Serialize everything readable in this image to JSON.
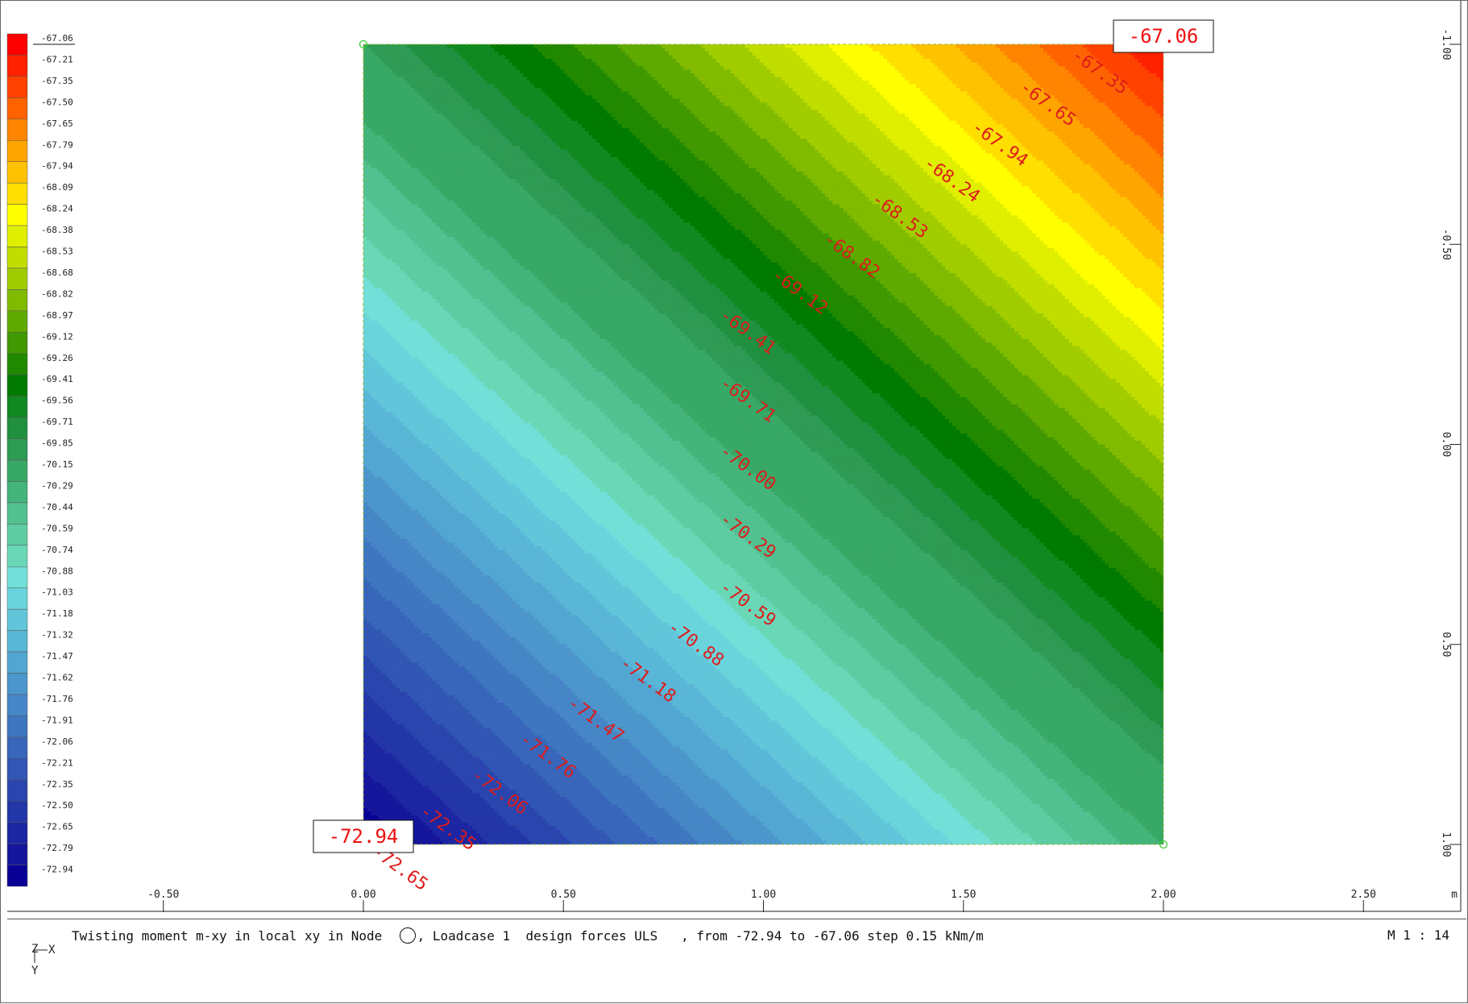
{
  "legend": {
    "values": [
      "-67.06",
      "-67.21",
      "-67.35",
      "-67.50",
      "-67.65",
      "-67.79",
      "-67.94",
      "-68.09",
      "-68.24",
      "-68.38",
      "-68.53",
      "-68.68",
      "-68.82",
      "-68.97",
      "-69.12",
      "-69.26",
      "-69.41",
      "-69.56",
      "-69.71",
      "-69.85",
      "-70.15",
      "-70.29",
      "-70.44",
      "-70.59",
      "-70.74",
      "-70.88",
      "-71.03",
      "-71.18",
      "-71.32",
      "-71.47",
      "-71.62",
      "-71.76",
      "-71.91",
      "-72.06",
      "-72.21",
      "-72.35",
      "-72.50",
      "-72.65",
      "-72.79",
      "-72.94"
    ],
    "colors": [
      "#ff0000",
      "#ff2100",
      "#ff4200",
      "#ff6300",
      "#ff8400",
      "#ffa500",
      "#ffc200",
      "#ffdf00",
      "#ffff00",
      "#e0ee00",
      "#c0dd00",
      "#a0cc00",
      "#80bb00",
      "#5faa00",
      "#409900",
      "#218900",
      "#007a00",
      "#108a20",
      "#209040",
      "#2e9b55",
      "#38a866",
      "#44b47a",
      "#52c090",
      "#5ecca2",
      "#6ad8b6",
      "#72e0d8",
      "#6ad4dc",
      "#62c6da",
      "#5ab6d6",
      "#52a6d2",
      "#4c96cc",
      "#4686c6",
      "#3f76c0",
      "#3866ba",
      "#3156b4",
      "#2a46ae",
      "#2336a8",
      "#1c26a2",
      "#15169c",
      "#0a0096"
    ]
  },
  "chart_data": {
    "type": "heatmap",
    "title": "Twisting moment m-xy in local xy in Node",
    "subtitle": ", Loadcase 1  design forces ULS   , from -72.94 to -67.06 step 0.15 kNm/m",
    "unit": "kNm/m",
    "min": -72.94,
    "max": -67.06,
    "step": 0.15,
    "x_ticks": [
      "-0.50",
      "0.00",
      "0.50",
      "1.00",
      "1.50",
      "2.00",
      "2.50"
    ],
    "x_tick_values": [
      -0.5,
      0,
      0.5,
      1,
      1.5,
      2,
      2.5
    ],
    "x_unit": "m",
    "y_ticks": [
      "-1.00",
      "-0.50",
      "0.00",
      "0.50",
      "1.00"
    ],
    "y_tick_values": [
      -1,
      -0.5,
      0,
      0.5,
      1
    ],
    "xlim": [
      -0.5,
      2.5
    ],
    "ylim": [
      -1.0,
      1.0
    ],
    "domain": {
      "x": [
        0,
        2
      ],
      "y": [
        -1,
        1
      ]
    },
    "corners": [
      {
        "x": 0,
        "y": -1,
        "value": -69.85
      },
      {
        "x": 2,
        "y": -1,
        "value": -67.06
      },
      {
        "x": 0,
        "y": 1,
        "value": -72.94
      },
      {
        "x": 2,
        "y": 1,
        "value": -70.15
      }
    ],
    "extremes": [
      {
        "label": "-67.06",
        "x": 2,
        "y": -1
      },
      {
        "label": "-72.94",
        "x": 0,
        "y": 1
      }
    ],
    "contour_labels": [
      {
        "text": "-67.35",
        "x": 1.84,
        "y": -0.93
      },
      {
        "text": "-67.65",
        "x": 1.71,
        "y": -0.85
      },
      {
        "text": "-67.94",
        "x": 1.59,
        "y": -0.75
      },
      {
        "text": "-68.24",
        "x": 1.47,
        "y": -0.66
      },
      {
        "text": "-68.53",
        "x": 1.34,
        "y": -0.57
      },
      {
        "text": "-68.82",
        "x": 1.22,
        "y": -0.47
      },
      {
        "text": "-69.12",
        "x": 1.09,
        "y": -0.38
      },
      {
        "text": "-69.41",
        "x": 0.96,
        "y": -0.28
      },
      {
        "text": "-69.71",
        "x": 0.96,
        "y": -0.11
      },
      {
        "text": "-70.00",
        "x": 0.96,
        "y": 0.06
      },
      {
        "text": "-70.29",
        "x": 0.96,
        "y": 0.23
      },
      {
        "text": "-70.59",
        "x": 0.96,
        "y": 0.4
      },
      {
        "text": "-70.88",
        "x": 0.83,
        "y": 0.5
      },
      {
        "text": "-71.18",
        "x": 0.71,
        "y": 0.59
      },
      {
        "text": "-71.47",
        "x": 0.58,
        "y": 0.69
      },
      {
        "text": "-71.76",
        "x": 0.46,
        "y": 0.78
      },
      {
        "text": "-72.06",
        "x": 0.34,
        "y": 0.87
      },
      {
        "text": "-72.35",
        "x": 0.21,
        "y": 0.96
      },
      {
        "text": "-72.65",
        "x": 0.09,
        "y": 1.06
      }
    ]
  },
  "footer": {
    "caption_part1": "Twisting moment m-xy in local xy in Node  ",
    "caption_part2": ", Loadcase 1  design forces ULS   , from -72.94 to -67.06 step 0.15 kNm/m",
    "scale": "M 1 : 14",
    "axis_z": "Z",
    "axis_x": "X",
    "axis_y": "Y"
  }
}
